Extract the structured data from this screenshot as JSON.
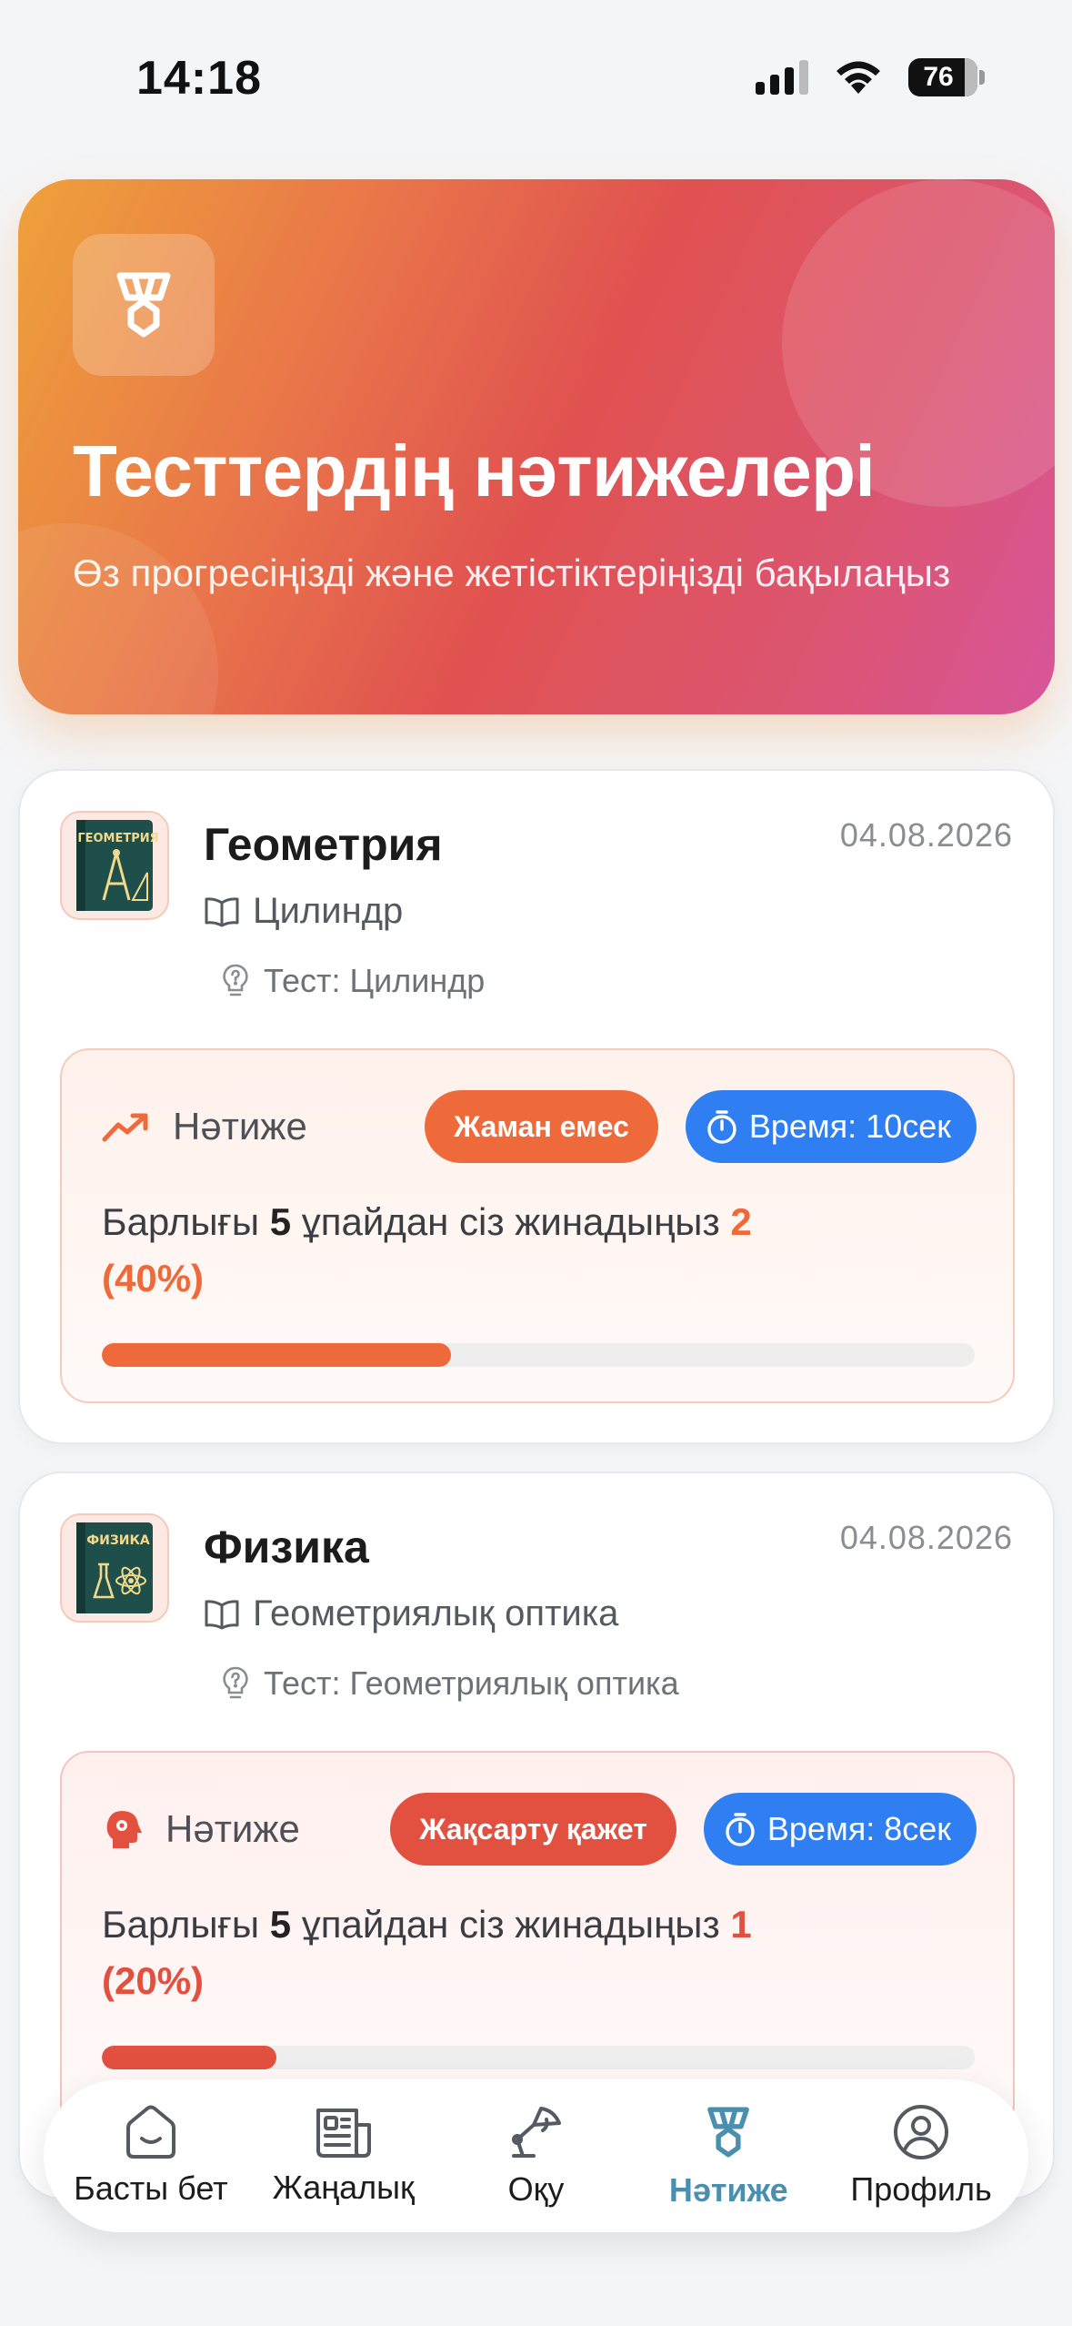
{
  "status_bar": {
    "time": "14:18",
    "battery": "76"
  },
  "hero": {
    "title": "Тесттердің нәтижелері",
    "subtitle": "Өз прогресіңізді және жетістіктеріңізді бақылаңыз",
    "gradient_colors": [
      "#eea13a",
      "#e05250",
      "#d8559a"
    ]
  },
  "results": [
    {
      "subject": "Геометрия",
      "cover_text": "ГЕОМЕТРИЯ",
      "date": "04.08.2026",
      "topic": "Цилиндр",
      "test": "Тест: Цилиндр",
      "result_label": "Нәтиже",
      "status_badge": "Жаман емес",
      "time_badge": "Время: 10сек",
      "text_prefix": "Барлығы",
      "total": "5",
      "text_middle": "ұпайдан сіз жинадыңыз",
      "score": "2",
      "percent": "(40%)",
      "progress_fraction": 0.4,
      "accent_color": "#ee6a3a"
    },
    {
      "subject": "Физика",
      "cover_text": "ФИЗИКА",
      "date": "04.08.2026",
      "topic": "Геометриялық оптика",
      "test": "Тест: Геометриялық оптика",
      "result_label": "Нәтиже",
      "status_badge": "Жақсарту қажет",
      "time_badge": "Время: 8сек",
      "text_prefix": "Барлығы",
      "total": "5",
      "text_middle": "ұпайдан сіз жинадыңыз",
      "score": "1",
      "percent": "(20%)",
      "progress_fraction": 0.2,
      "accent_color": "#e2503f"
    }
  ],
  "tabs": [
    {
      "label": "Басты бет",
      "icon": "home-icon"
    },
    {
      "label": "Жаңалық",
      "icon": "news-icon"
    },
    {
      "label": "Оқу",
      "icon": "study-lamp-icon"
    },
    {
      "label": "Нәтиже",
      "icon": "medal-icon",
      "active": true
    },
    {
      "label": "Профиль",
      "icon": "profile-icon"
    }
  ],
  "colors": {
    "active_tab": "#4a8fae",
    "time_badge": "#2f7ff3"
  }
}
